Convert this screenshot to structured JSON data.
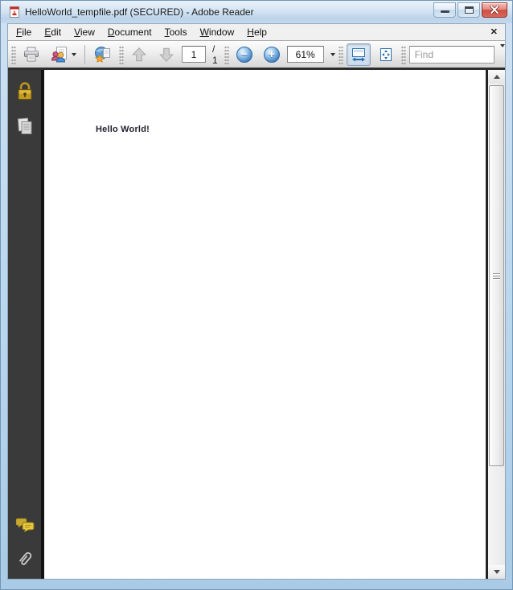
{
  "window": {
    "title": "HelloWorld_tempfile.pdf (SECURED) - Adobe Reader",
    "app_icon": "adobe-reader-pdf-icon",
    "control_icons": [
      "minimize-icon",
      "maximize-icon",
      "close-icon"
    ]
  },
  "menu_bar": {
    "items": [
      "File",
      "Edit",
      "View",
      "Document",
      "Tools",
      "Window",
      "Help"
    ],
    "close_glyph": "✕"
  },
  "toolbar": {
    "icons": [
      "printer-icon",
      "share-with-people-icon",
      "collaborate-globe-icon",
      "previous-page-arrow-icon",
      "next-page-arrow-icon",
      "zoom-out-icon",
      "zoom-in-icon",
      "fit-width-icon",
      "fit-page-icon"
    ],
    "zoom_out_glyph": "−",
    "zoom_in_glyph": "+",
    "page": {
      "current": "1",
      "of_label": "/ 1"
    },
    "zoom": {
      "value": "61%"
    },
    "find": {
      "placeholder": "Find"
    }
  },
  "sidebar": {
    "items": [
      {
        "id": "security",
        "icon": "lock-icon"
      },
      {
        "id": "pages",
        "icon": "pages-icon"
      },
      {
        "id": "comments",
        "icon": "comments-icon"
      },
      {
        "id": "attachments",
        "icon": "paperclip-icon"
      }
    ]
  },
  "document": {
    "text": "Hello World!"
  },
  "colors": {
    "window_border": "#b7d5ec",
    "titlebar_top": "#e9f2fb",
    "titlebar_bottom": "#bcd3e9",
    "menubar_bg": "#f0f0f0",
    "toolbar_bottom_border": "#2e2e2e",
    "sidebar_bg": "#3a3a3a",
    "close_button_red": "#cd4f43",
    "lock_gold": "#c49a24",
    "comments_gold": "#e6c838",
    "zoom_circle_blue": "#3d7ec0",
    "fit_icon_blue": "#2a6cb0",
    "document_text": "#1f1f2b"
  }
}
